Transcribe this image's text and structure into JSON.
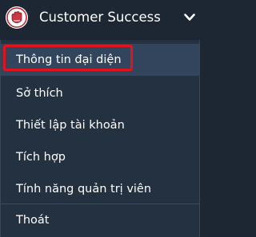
{
  "header": {
    "title": "Customer Success",
    "logo_icon": "hand-emblem-icon",
    "toggle_icon": "chevron-down-icon"
  },
  "menu": {
    "items": [
      {
        "label": "Thông tin đại diện",
        "active": true
      },
      {
        "label": "Sở thích"
      },
      {
        "label": "Thiết lập tài khoản"
      },
      {
        "label": "Tích hợp"
      },
      {
        "label": "Tính năng quản trị viên"
      },
      {
        "label": "Thoát"
      }
    ]
  },
  "colors": {
    "background": "#1c2733",
    "menu_background": "#243141",
    "active_background": "#33455d",
    "highlight_border": "#e0141e"
  }
}
